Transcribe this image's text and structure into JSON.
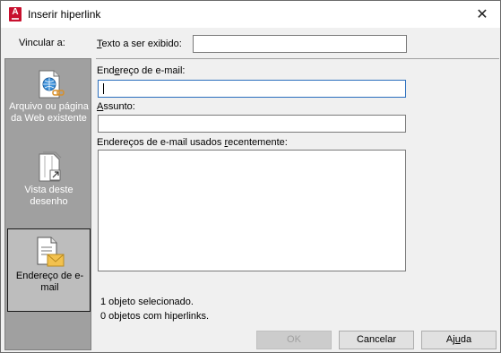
{
  "window": {
    "title": "Inserir hiperlink",
    "app_icon_letter": "A",
    "close_glyph": "✕"
  },
  "link_to": {
    "label": "Vincular a:",
    "items": [
      {
        "icon": "web-page-globe-icon",
        "label": "Arquivo ou página da Web existente",
        "selected": false
      },
      {
        "icon": "drawing-view-icon",
        "label": "Vista deste desenho",
        "selected": false
      },
      {
        "icon": "email-address-icon",
        "label": "Endereço de e-mail",
        "selected": true
      }
    ]
  },
  "form": {
    "display_text": {
      "label_prefix": "",
      "label_key": "T",
      "label_rest": "exto a ser exibido:",
      "value": ""
    },
    "email": {
      "label_prefix": "End",
      "label_key": "e",
      "label_rest": "reço de e-mail:",
      "value": ""
    },
    "subject": {
      "label_prefix": "",
      "label_key": "A",
      "label_rest": "ssunto:",
      "value": ""
    },
    "recent": {
      "label_prefix": "Endereços de e-mail usados ",
      "label_key": "r",
      "label_rest": "ecentemente:",
      "items": []
    }
  },
  "status": {
    "selected_objects": "1 objeto selecionado.",
    "hyperlinked_objects": "0 objetos com hiperlinks."
  },
  "buttons": {
    "ok": "OK",
    "cancel": "Cancelar",
    "help_prefix": "Aj",
    "help_key": "u",
    "help_rest": "da"
  },
  "colors": {
    "sidebar": "#a0a0a0",
    "selected_item": "#bdbdbd",
    "focus_border": "#2a6ebd",
    "app_icon": "#c8102e"
  }
}
